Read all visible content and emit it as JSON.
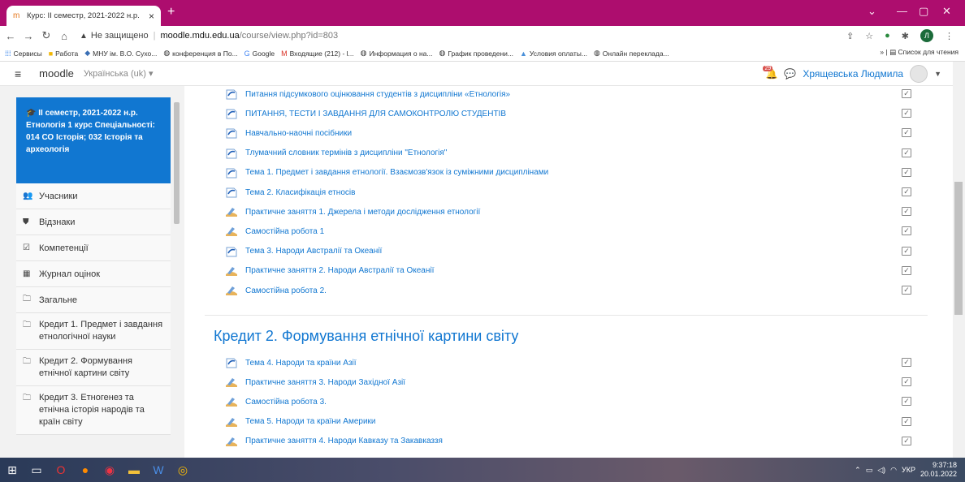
{
  "browser": {
    "tab_title": "Курс: II семестр, 2021-2022 н.р.",
    "insecure": "Не защищено",
    "url_host": "moodle.mdu.edu.ua",
    "url_path": "/course/view.php?id=803",
    "bookmarks": [
      "Сервисы",
      "Работа",
      "МНУ ім. В.О. Сухо...",
      "конференция в По...",
      "Google",
      "Входящие (212) - l...",
      "Информация о на...",
      "График проведени...",
      "Условия оплаты...",
      "Онлайн переклада..."
    ],
    "reading_list": "Список для чтения"
  },
  "navbar": {
    "brand": "moodle",
    "lang": "Українська (uk)",
    "notifications": "29",
    "user": "Хрящевська Людмила"
  },
  "drawer": {
    "course": "II семестр, 2021-2022 н.р. Етнологія 1 курс Спеціальності: 014 СО Історія; 032 Історія та археологія",
    "links": [
      "Учасники",
      "Відзнаки",
      "Компетенції",
      "Журнал оцінок",
      "Загальне"
    ],
    "sections": [
      "Кредит 1. Предмет і завдання етнологічної науки",
      "Кредит 2. Формування етнічної картини світу",
      "Кредит 3. Етногенез та етнічна історія народів та країн світу"
    ]
  },
  "content": {
    "activities1": [
      {
        "title": "Питання підсумкового оцінювання студентів з дисципліни «Етнологія»",
        "type": "file"
      },
      {
        "title": "ПИТАННЯ, ТЕСТИ І ЗАВДАННЯ ДЛЯ САМОКОНТРОЛЮ СТУДЕНТІВ",
        "type": "file"
      },
      {
        "title": "Навчально-наочні посібники",
        "type": "file"
      },
      {
        "title": "Тлумачний словник термінів з дисципліни \"Етнологія\"",
        "type": "file"
      },
      {
        "title": "Тема 1. Предмет і завдання етнології. Взаємозв'язок із суміжними дисциплінами",
        "type": "file"
      },
      {
        "title": "Тема 2. Класифікація етносів",
        "type": "file"
      },
      {
        "title": "Практичне заняття 1. Джерела і методи дослідження етнології",
        "type": "assign"
      },
      {
        "title": "Самостійна робота 1",
        "type": "assign"
      },
      {
        "title": "Тема 3. Народи Австралії та Океанії",
        "type": "file"
      },
      {
        "title": "Практичне заняття 2. Народи Австралії та Океанії",
        "type": "assign"
      },
      {
        "title": "Самостійна робота 2.",
        "type": "assign"
      }
    ],
    "section2_title": "Кредит 2. Формування етнічної картини світу",
    "activities2": [
      {
        "title": "Тема 4. Народи та країни Азії",
        "type": "file"
      },
      {
        "title": "Практичне заняття 3. Народи Західної Азії",
        "type": "assign"
      },
      {
        "title": "Самостійна робота 3.",
        "type": "assign"
      },
      {
        "title": "Тема 5. Народи та країни Америки",
        "type": "assign"
      },
      {
        "title": "Практичне заняття 4. Народи Кавказу та Закавказзя",
        "type": "assign"
      }
    ]
  },
  "taskbar": {
    "lang": "УКР",
    "time": "9:37:18",
    "date": "20.01.2022"
  },
  "colors": {
    "chrome": "#ad0d6e",
    "link": "#1177d1"
  }
}
